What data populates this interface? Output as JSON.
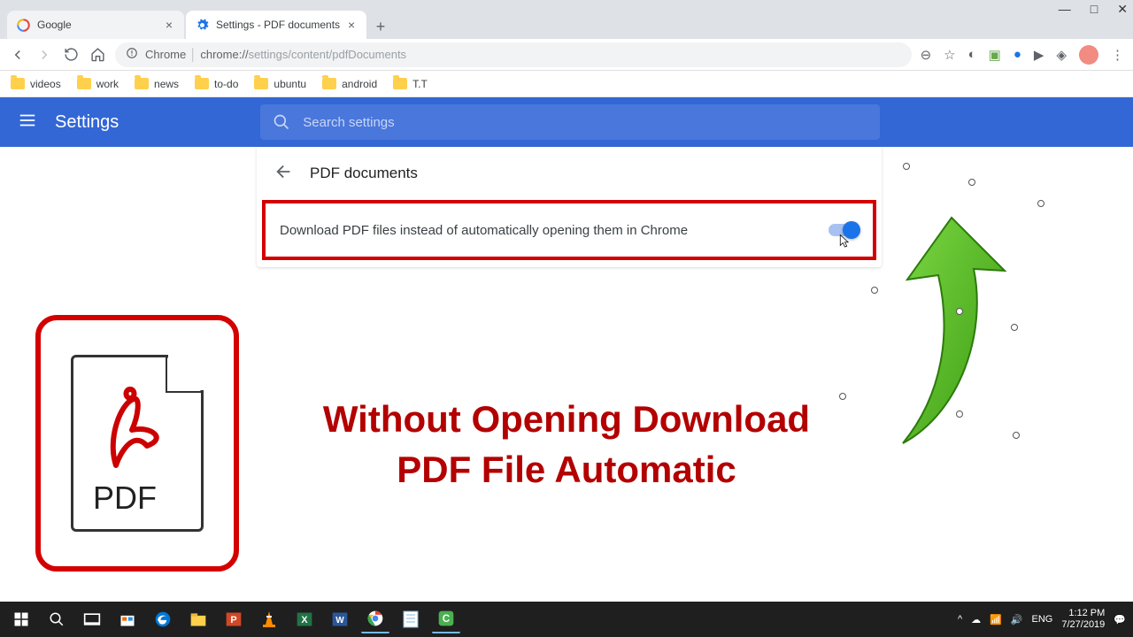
{
  "tabs": [
    {
      "label": "Google"
    },
    {
      "label": "Settings - PDF documents"
    }
  ],
  "address": {
    "app": "Chrome",
    "host": "chrome://",
    "path": "settings/content/pdfDocuments"
  },
  "bookmarks": [
    "videos",
    "work",
    "news",
    "to-do",
    "ubuntu",
    "android",
    "T.T"
  ],
  "app": {
    "title": "Settings",
    "searchPlaceholder": "Search settings"
  },
  "page": {
    "heading": "PDF documents",
    "toggleLabel": "Download PDF files instead of automatically opening them in Chrome"
  },
  "overlay": {
    "line1": "Without Opening Download",
    "line2": "PDF File Automatic",
    "pdfLabel": "PDF"
  },
  "tray": {
    "lang": "ENG",
    "time": "1:12 PM",
    "date": "7/27/2019"
  }
}
